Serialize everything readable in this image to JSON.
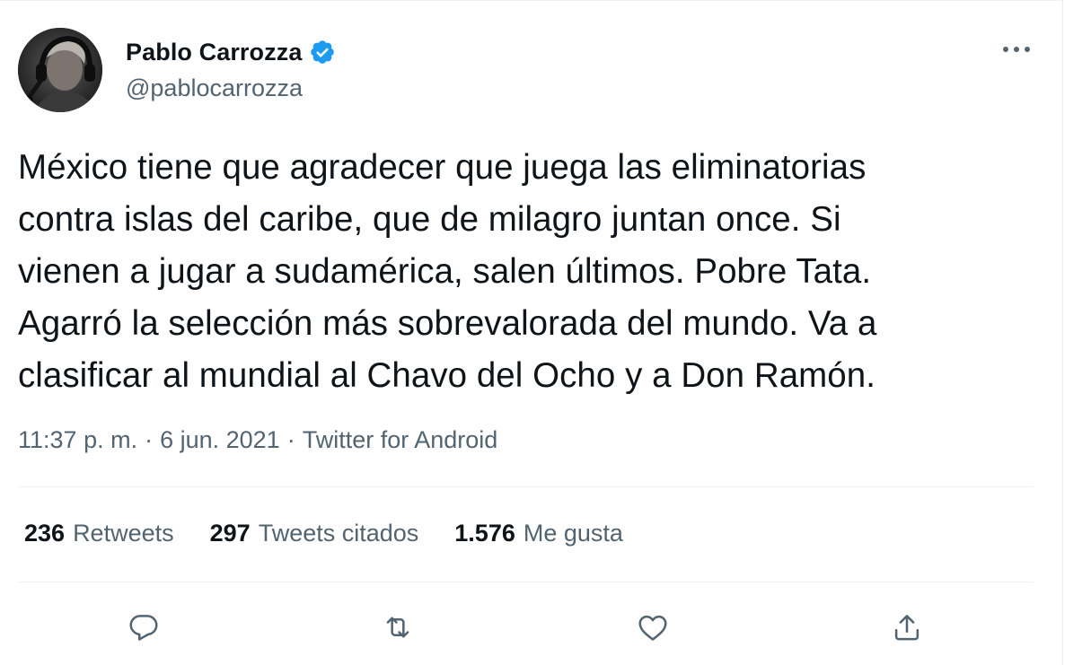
{
  "author": {
    "name": "Pablo Carrozza",
    "handle": "@pablocarrozza",
    "verified": true
  },
  "tweet": {
    "text": "México tiene que agradecer que juega las eliminatorias\ncontra islas del caribe, que de milagro juntan once. Si\nvienen a jugar a sudamérica, salen últimos. Pobre Tata.\nAgarró la selección más sobrevalorada del mundo. Va a\nclasificar al mundial al Chavo del Ocho y a Don Ramón."
  },
  "meta": {
    "time": "11:37 p. m.",
    "date": "6 jun. 2021",
    "source": "Twitter for Android",
    "separator": "·"
  },
  "stats": {
    "retweets_count": "236",
    "retweets_label": "Retweets",
    "quotes_count": "297",
    "quotes_label": "Tweets citados",
    "likes_count": "1.576",
    "likes_label": "Me gusta"
  },
  "actions": {
    "icons": [
      "reply-icon",
      "retweet-icon",
      "like-icon",
      "share-icon"
    ],
    "icon_color": "#536471"
  },
  "colors": {
    "verified_badge": "#1d9bf0",
    "primary_text": "#0f1419",
    "secondary_text": "#536471",
    "divider": "#eff3f4"
  }
}
